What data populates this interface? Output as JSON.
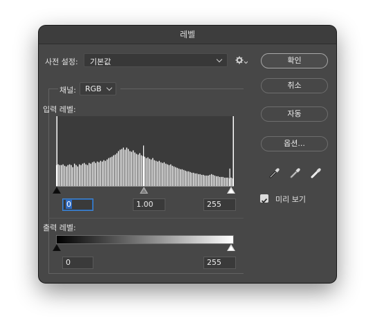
{
  "dialog": {
    "title": "레벨"
  },
  "preset": {
    "label": "사전 설정:",
    "value": "기본값"
  },
  "channel": {
    "label": "채널:",
    "value": "RGB"
  },
  "input_levels": {
    "label": "입력 레벨:",
    "black": "0",
    "gamma": "1.00",
    "white": "255"
  },
  "output_levels": {
    "label": "출력 레벨:",
    "black": "0",
    "white": "255"
  },
  "buttons": {
    "ok": "확인",
    "cancel": "취소",
    "auto": "자동",
    "options": "옵션..."
  },
  "preview": {
    "label": "미리 보기",
    "checked": true
  },
  "histogram": {
    "values": [
      0.3,
      0.31,
      0.3,
      0.3,
      0.31,
      0.29,
      0.28,
      0.3,
      0.31,
      0.3,
      0.27,
      0.32,
      0.3,
      0.28,
      0.31,
      0.3,
      0.32,
      0.33,
      0.31,
      0.3,
      0.33,
      0.32,
      0.34,
      0.35,
      0.33,
      0.35,
      0.34,
      0.36,
      0.35,
      0.37,
      0.36,
      0.38,
      0.4,
      0.41,
      0.42,
      0.44,
      0.45,
      0.47,
      0.5,
      0.52,
      0.53,
      0.55,
      0.52,
      0.55,
      0.53,
      0.5,
      0.49,
      0.51,
      0.48,
      0.46,
      0.45,
      0.47,
      0.44,
      0.43,
      0.42,
      0.4,
      0.41,
      0.39,
      0.38,
      0.4,
      0.37,
      0.36,
      0.35,
      0.36,
      0.34,
      0.33,
      0.34,
      0.32,
      0.31,
      0.3,
      0.31,
      0.29,
      0.28,
      0.27,
      0.26,
      0.25,
      0.24,
      0.24,
      0.23,
      0.22,
      0.21,
      0.21,
      0.2,
      0.19,
      0.19,
      0.18,
      0.18,
      0.17,
      0.17,
      0.16,
      0.16,
      0.15,
      0.15,
      0.15,
      0.16,
      0.17,
      0.16,
      0.15,
      0.14,
      0.14,
      0.13,
      0.13,
      0.13,
      0.12,
      0.12,
      0.12,
      0.11,
      0.12,
      0.11
    ],
    "spikes": [
      {
        "at": 0.49,
        "value": 0.58
      },
      {
        "at": 0.975,
        "value": 0.25
      }
    ]
  }
}
